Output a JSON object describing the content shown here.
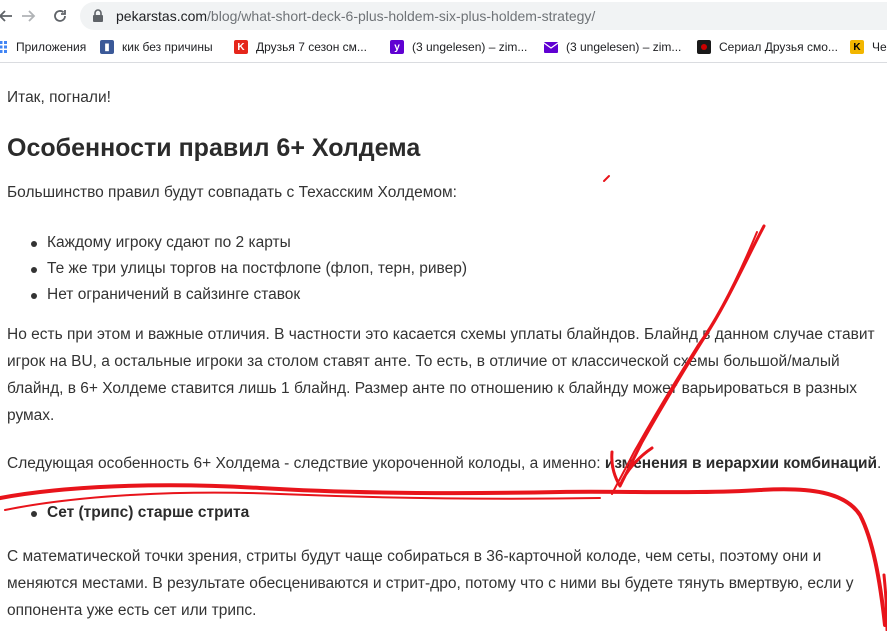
{
  "browser": {
    "url_host": "pekarstas.com",
    "url_path": "/blog/what-short-deck-6-plus-holdem-six-plus-holdem-strategy/",
    "bookmarks": [
      {
        "label": "Приложения",
        "icon": "apps-grid-icon",
        "color": "#4285f4"
      },
      {
        "label": "кик без причины",
        "icon": "bookmark-favicon-icon",
        "color": "#3b5998"
      },
      {
        "label": "Друзья 7 сезон см...",
        "icon": "ki-favicon-icon",
        "color": "#e5261b"
      },
      {
        "label": "(3 ungelesen) – zim...",
        "icon": "yahoo-favicon-icon",
        "color": "#6001d2"
      },
      {
        "label": "(3 ungelesen) – zim...",
        "icon": "mail-icon",
        "color": "#6001d2"
      },
      {
        "label": "Сериал Друзья смо...",
        "icon": "record-favicon-icon",
        "color": "#cc0000"
      },
      {
        "label": "Че",
        "icon": "k-favicon-icon",
        "color": "#f2b600"
      }
    ]
  },
  "article": {
    "intro": "Итак, погнали!",
    "heading": "Особенности правил 6+ Холдема",
    "p1": "Большинство правил будут совпадать с Техасским Холдемом:",
    "list1": [
      "Каждому игроку сдают по 2 карты",
      "Те же три улицы торгов на постфлопе (флоп, терн, ривер)",
      "Нет ограничений в сайзинге ставок"
    ],
    "p2_lines": [
      "Но есть при этом и важные отличия. В частности это касается схемы уплаты блайндов. Блайнд в данном случае ставит",
      "игрок на BU, а остальные игроки за столом ставят анте. То есть, в отличие от классической схемы большой/малый",
      "блайнд, в 6+ Холдеме ставится лишь 1 блайнд. Размер анте по отношению к блайнду может варьироваться в разных",
      "румах."
    ],
    "p3_text": "Следующая особенность 6+ Холдема - следствие укороченной колоды, а именно: ",
    "p3_bold": "изменения в иерархии комбинаций",
    "p3_end": ".",
    "list2": [
      "Сет (трипс) старше стрита"
    ],
    "p4_lines": [
      "С математической точки зрения, стриты будут чаще собираться в 36-карточной колоде, чем сеты, поэтому они и",
      "меняются местами. В результате обесцениваются и стрит-дро, потому что с ними вы будете тянуть вмертвую, если у",
      "оппонента уже есть сет или трипс."
    ]
  },
  "colors": {
    "scribble": "#e8141b",
    "text": "#333333"
  }
}
